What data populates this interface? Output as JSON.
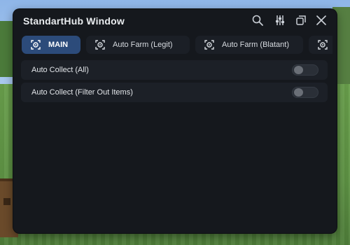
{
  "window": {
    "title": "StandartHub Window",
    "controls": [
      "search-icon",
      "sliders-icon",
      "restore-icon",
      "close-icon"
    ]
  },
  "tabs": [
    {
      "label": "MAIN",
      "icon": "target-icon",
      "active": true
    },
    {
      "label": "Auto Farm (Legit)",
      "icon": "target-icon",
      "active": false
    },
    {
      "label": "Auto Farm (Blatant)",
      "icon": "target-icon",
      "active": false
    },
    {
      "label": "",
      "icon": "target-icon",
      "active": false
    }
  ],
  "toggles": [
    {
      "label": "Auto Collect (All)",
      "enabled": false
    },
    {
      "label": "Auto Collect (Filter Out Items)",
      "enabled": false
    }
  ],
  "colors": {
    "window_bg": "#15181d",
    "active_tab": "#2c4b7a",
    "row_bg": "#1c2027",
    "text": "#e9ecef"
  }
}
